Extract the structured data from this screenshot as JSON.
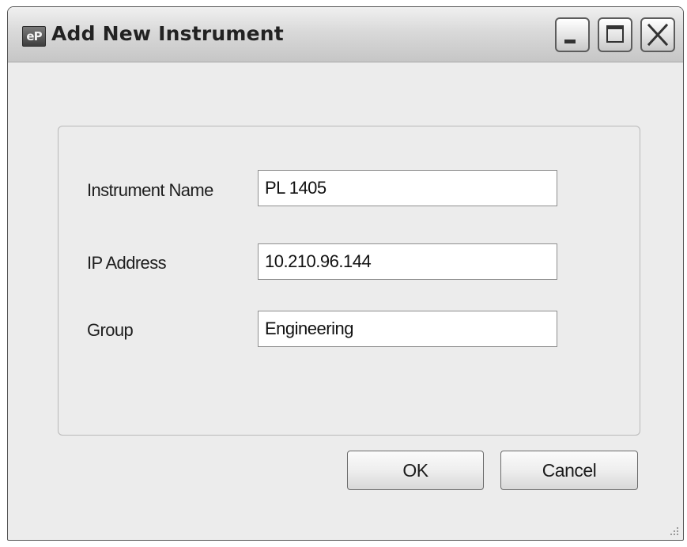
{
  "window": {
    "title": "Add New Instrument",
    "app_icon_text": "eP"
  },
  "title_controls": {
    "minimize_icon": "minimize-icon",
    "maximize_icon": "maximize-icon",
    "close_icon": "close-icon"
  },
  "form": {
    "fields": [
      {
        "label": "Instrument Name",
        "value": "PL 1405"
      },
      {
        "label": "IP Address",
        "value": "10.210.96.144"
      },
      {
        "label": "Group",
        "value": "Engineering"
      }
    ]
  },
  "buttons": {
    "ok_label": "OK",
    "cancel_label": "Cancel"
  },
  "colors": {
    "window_background": "#ececec",
    "titlebar_top": "#f0f0f0",
    "titlebar_bottom": "#c6c6c6",
    "input_background": "#ffffff"
  }
}
